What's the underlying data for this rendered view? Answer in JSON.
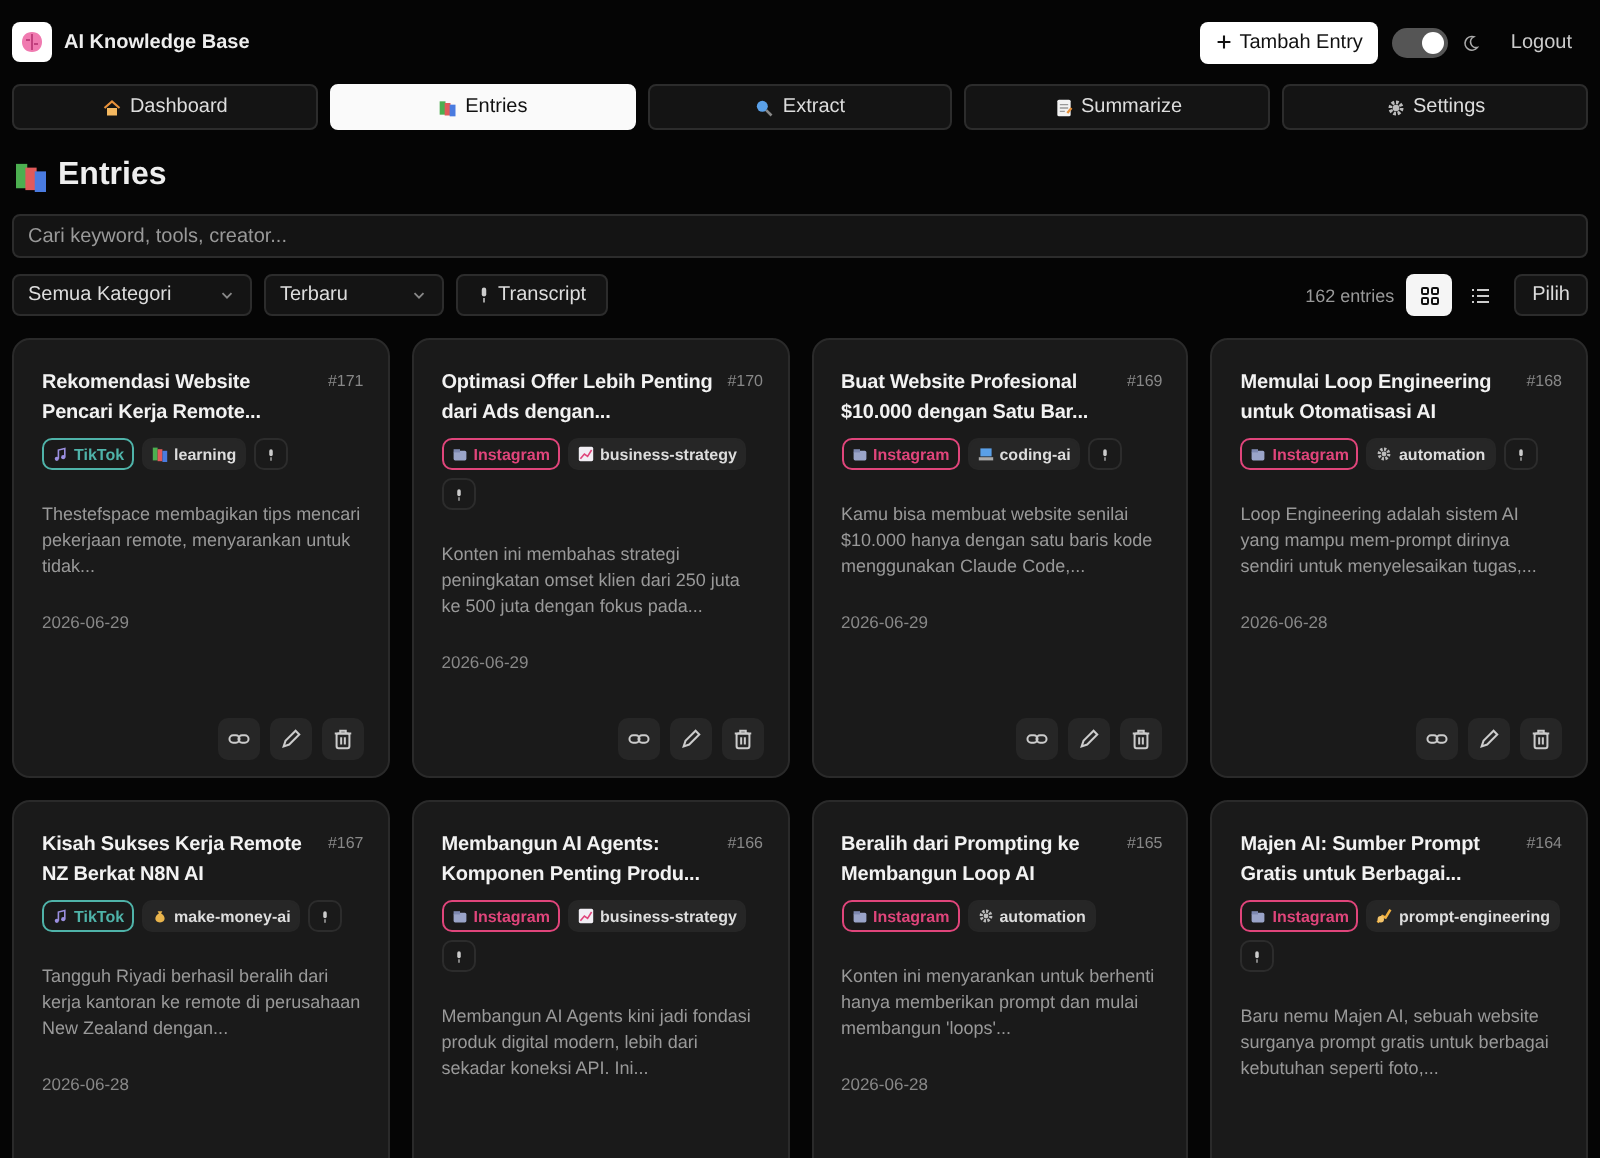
{
  "app": {
    "title": "AI Knowledge Base"
  },
  "header": {
    "add_button": "Tambah Entry",
    "theme_toggle": {
      "on": true
    },
    "logout": "Logout"
  },
  "tabs": [
    {
      "label": "Dashboard",
      "kind": "house",
      "selected": false
    },
    {
      "label": "Entries",
      "kind": "books",
      "selected": true
    },
    {
      "label": "Extract",
      "kind": "search",
      "selected": false
    },
    {
      "label": "Summarize",
      "kind": "memo",
      "selected": false
    },
    {
      "label": "Settings",
      "kind": "gear",
      "selected": false
    }
  ],
  "page": {
    "title": "Entries"
  },
  "search": {
    "placeholder": "Cari keyword, tools, creator..."
  },
  "filters": {
    "category": "Semua Kategori",
    "sort": "Terbaru",
    "transcript_button": "Transcript",
    "count": "162 entries",
    "views": [
      {
        "kind": "grid",
        "selected": true
      },
      {
        "kind": "list",
        "selected": false
      }
    ],
    "select_button": "Pilih"
  },
  "entries": [
    {
      "id": "#171",
      "title": "Rekomendasi Website Pencari Kerja Remote...",
      "platform": {
        "label": "TikTok",
        "kind": "tiktok",
        "color": "#4fb3a9"
      },
      "category": {
        "label": "learning",
        "kind": "books"
      },
      "transcript": true,
      "description": "Thestefspace membagikan tips mencari pekerjaan remote, menyarankan untuk tidak...",
      "date": "2026-06-29"
    },
    {
      "id": "#170",
      "title": "Optimasi Offer Lebih Penting dari Ads dengan...",
      "platform": {
        "label": "Instagram",
        "kind": "instagram",
        "color": "#e0457b"
      },
      "category": {
        "label": "business-strategy",
        "kind": "chart"
      },
      "transcript": true,
      "description": "Konten ini membahas strategi peningkatan omset klien dari 250 juta ke 500 juta dengan fokus pada...",
      "date": "2026-06-29"
    },
    {
      "id": "#169",
      "title": "Buat Website Profesional $10.000 dengan Satu Bar...",
      "platform": {
        "label": "Instagram",
        "kind": "instagram",
        "color": "#e0457b"
      },
      "category": {
        "label": "coding-ai",
        "kind": "laptop"
      },
      "transcript": true,
      "description": "Kamu bisa membuat website senilai $10.000 hanya dengan satu baris kode menggunakan Claude Code,...",
      "date": "2026-06-29"
    },
    {
      "id": "#168",
      "title": "Memulai Loop Engineering untuk Otomatisasi AI",
      "platform": {
        "label": "Instagram",
        "kind": "instagram",
        "color": "#e0457b"
      },
      "category": {
        "label": "automation",
        "kind": "gear"
      },
      "transcript": true,
      "description": "Loop Engineering adalah sistem AI yang mampu mem-prompt dirinya sendiri untuk menyelesaikan tugas,...",
      "date": "2026-06-28"
    },
    {
      "id": "#167",
      "title": "Kisah Sukses Kerja Remote NZ Berkat N8N AI",
      "platform": {
        "label": "TikTok",
        "kind": "tiktok",
        "color": "#4fb3a9"
      },
      "category": {
        "label": "make-money-ai",
        "kind": "money"
      },
      "transcript": true,
      "description": "Tangguh Riyadi berhasil beralih dari kerja kantoran ke remote di perusahaan New Zealand dengan...",
      "date": "2026-06-28"
    },
    {
      "id": "#166",
      "title": "Membangun AI Agents: Komponen Penting Produ...",
      "platform": {
        "label": "Instagram",
        "kind": "instagram",
        "color": "#e0457b"
      },
      "category": {
        "label": "business-strategy",
        "kind": "chart"
      },
      "transcript": true,
      "description": "Membangun AI Agents kini jadi fondasi produk digital modern, lebih dari sekadar koneksi API. Ini..."
    },
    {
      "id": "#165",
      "title": "Beralih dari Prompting ke Membangun Loop AI",
      "platform": {
        "label": "Instagram",
        "kind": "instagram",
        "color": "#e0457b"
      },
      "category": {
        "label": "automation",
        "kind": "gear"
      },
      "transcript": false,
      "description": "Konten ini menyarankan untuk berhenti hanya memberikan prompt dan mulai membangun 'loops'...",
      "date": "2026-06-28"
    },
    {
      "id": "#164",
      "title": "Majen AI: Sumber Prompt Gratis untuk Berbagai...",
      "platform": {
        "label": "Instagram",
        "kind": "instagram",
        "color": "#e0457b"
      },
      "category": {
        "label": "prompt-engineering",
        "kind": "writing"
      },
      "transcript": true,
      "description": "Baru nemu Majen AI, sebuah website surganya prompt gratis untuk berbagai kebutuhan seperti foto,..."
    }
  ]
}
